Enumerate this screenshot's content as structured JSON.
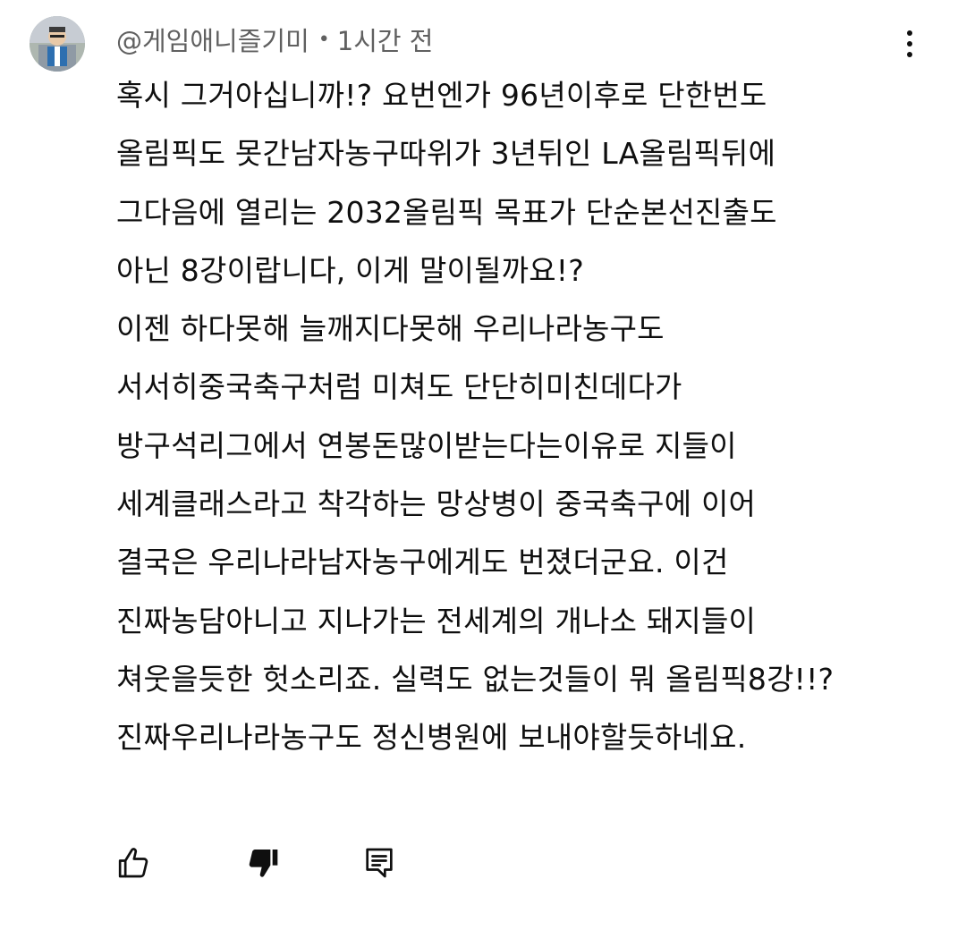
{
  "comment": {
    "author": "@게임애니즐기미",
    "separator": "•",
    "timestamp": "1시간 전",
    "lines": [
      "혹시 그거아십니까!? 요번엔가 96년이후로 단한번도",
      "올림픽도 못간남자농구따위가 3년뒤인 LA올림픽뒤에",
      "그다음에 열리는 2032올림픽 목표가 단순본선진출도",
      "아닌 8강이랍니다, 이게 말이될까요!?",
      "이젠 하다못해 늘깨지다못해 우리나라농구도",
      "서서히중국축구처럼 미쳐도 단단히미친데다가",
      "방구석리그에서 연봉돈많이받는다는이유로 지들이",
      "세계클래스라고 착각하는 망상병이 중국축구에 이어",
      "결국은 우리나라남자농구에게도 번졌더군요. 이건",
      "진짜농담아니고 지나가는 전세계의 개나소 돼지들이",
      "쳐웃을듯한 헛소리죠. 실력도 없는것들이 뭐 올림픽8강!!?",
      "진짜우리나라농구도 정신병원에 보내야할듯하네요."
    ]
  },
  "icons": {
    "avatar": "avatar-image",
    "more": "more-vert-icon",
    "like": "thumb-up-outline-icon",
    "dislike": "thumb-down-filled-icon",
    "reply": "reply-comment-icon"
  },
  "colors": {
    "text_primary": "#0f0f0f",
    "text_secondary": "#606060",
    "background": "#ffffff"
  }
}
